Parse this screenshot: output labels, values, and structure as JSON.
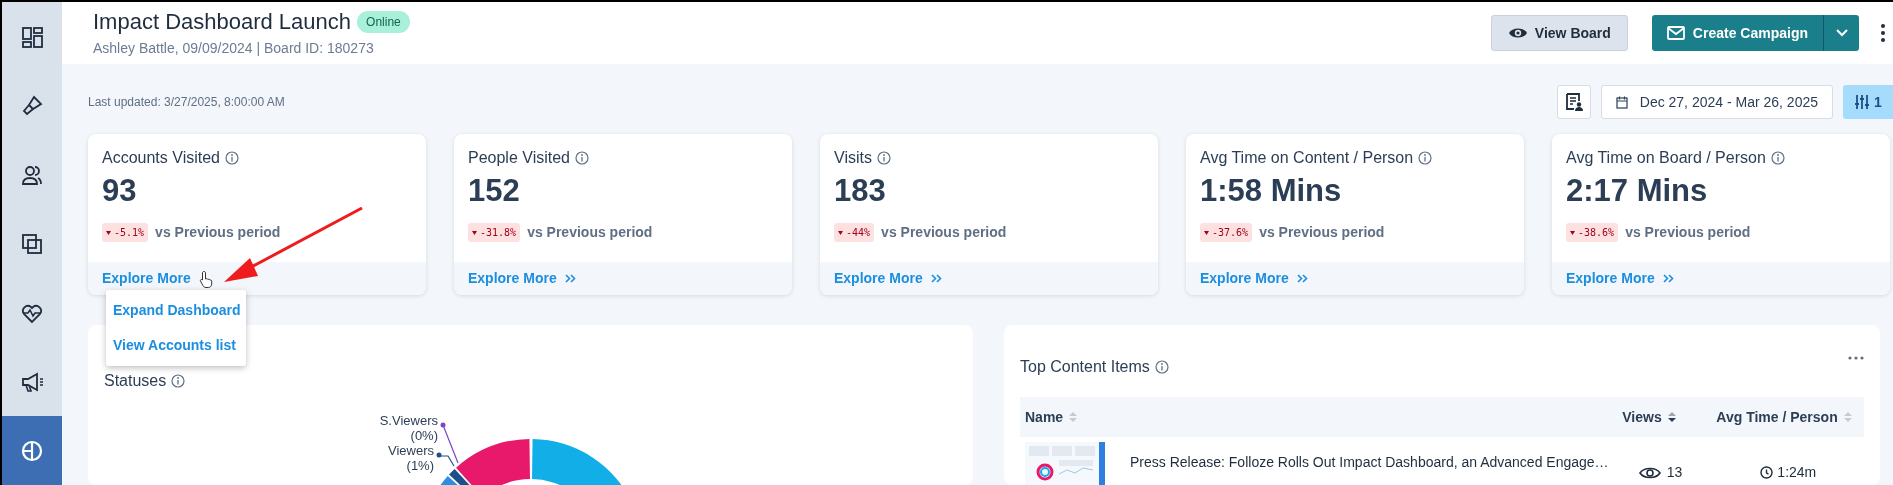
{
  "sidebar": {
    "items": [
      {
        "kind": "dashboard",
        "selected": false
      },
      {
        "kind": "brush",
        "selected": false
      },
      {
        "kind": "people",
        "selected": false
      },
      {
        "kind": "copy",
        "selected": false
      },
      {
        "kind": "pulse",
        "selected": false
      },
      {
        "kind": "megaphone",
        "selected": false
      },
      {
        "kind": "pie",
        "selected": true
      }
    ]
  },
  "header": {
    "title": "Impact Dashboard Launch",
    "status": "Online",
    "subtitle": "Ashley Battle, 09/09/2024 | Board ID: 180273",
    "view_button": "View Board",
    "create_button": "Create Campaign"
  },
  "toolbar": {
    "last_updated": "Last updated: 3/27/2025, 8:00:00 AM",
    "date_range": "Dec 27, 2024 - Mar 26, 2025",
    "filter_count": "1"
  },
  "metrics": [
    {
      "title": "Accounts Visited",
      "value": "93",
      "change": "-5.1%",
      "comparison": "vs Previous period",
      "link": "Explore More",
      "menu_open": true
    },
    {
      "title": "People Visited",
      "value": "152",
      "change": "-31.8%",
      "comparison": "vs Previous period",
      "link": "Explore More",
      "menu_open": false
    },
    {
      "title": "Visits",
      "value": "183",
      "change": "-44%",
      "comparison": "vs Previous period",
      "link": "Explore More",
      "menu_open": false
    },
    {
      "title": "Avg Time on Content / Person",
      "value": "1:58 Mins",
      "change": "-37.6%",
      "comparison": "vs Previous period",
      "link": "Explore More",
      "menu_open": false
    },
    {
      "title": "Avg Time on Board / Person",
      "value": "2:17 Mins",
      "change": "-38.6%",
      "comparison": "vs Previous period",
      "link": "Explore More",
      "menu_open": false
    }
  ],
  "explore_menu": {
    "items": [
      "Expand Dashboard",
      "View Accounts list"
    ]
  },
  "statuses": {
    "title": "Statuses",
    "labels": [
      {
        "name": "S.Viewers",
        "percent": "(0%)",
        "color": "#7b45c9"
      },
      {
        "name": "Viewers",
        "percent": "(1%)",
        "color": "#1f4e8c"
      }
    ]
  },
  "top_content": {
    "title": "Top Content Items",
    "columns": [
      {
        "label": "Name",
        "sorted": false
      },
      {
        "label": "Views",
        "sorted": true
      },
      {
        "label": "Avg Time / Person",
        "sorted": false
      }
    ],
    "rows": [
      {
        "name": "Press Release: Folloze Rolls Out Impact Dashboard, an Advanced Engage…",
        "views": "13",
        "avg_time": "1:24m"
      }
    ]
  }
}
